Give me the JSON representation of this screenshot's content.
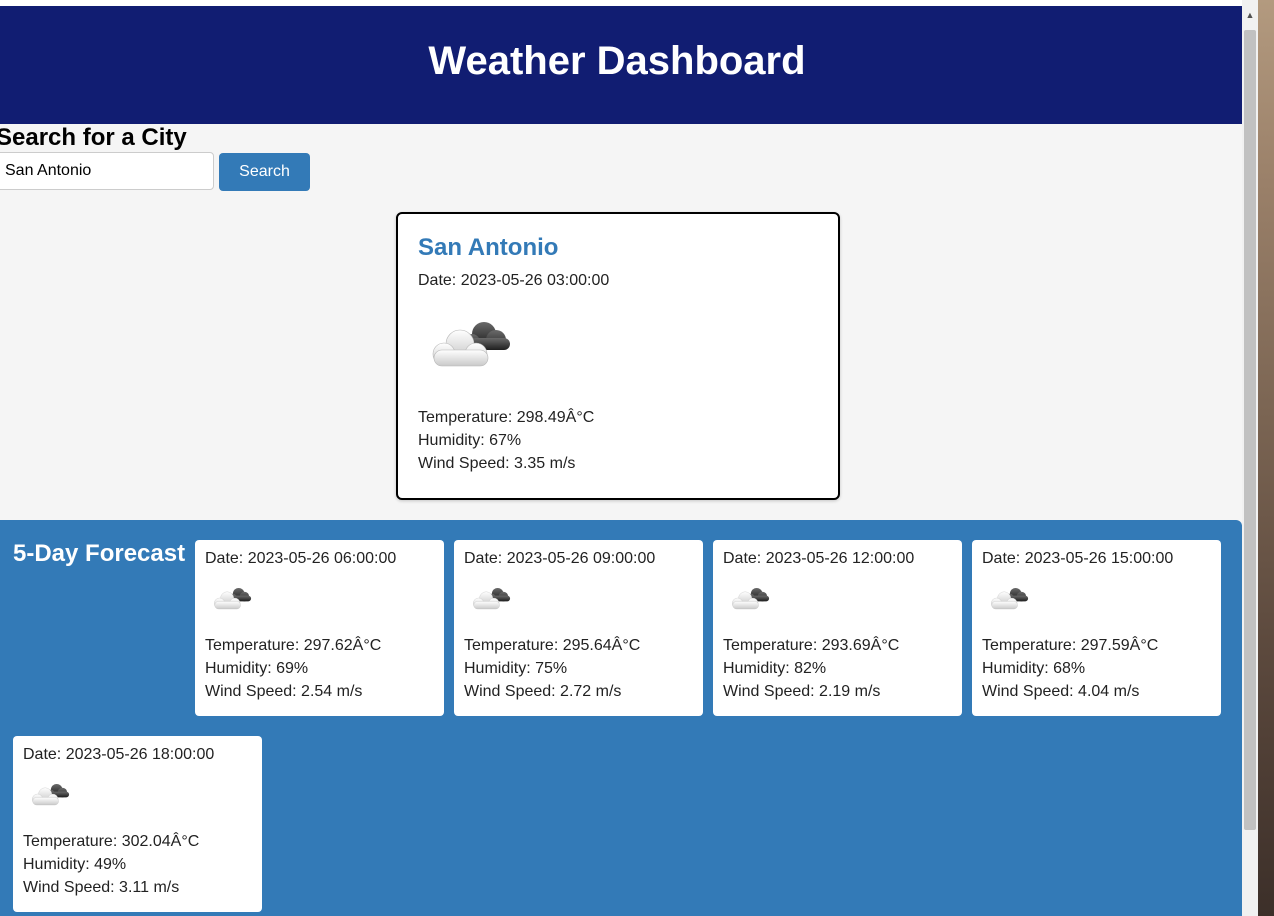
{
  "header": {
    "title": "Weather Dashboard"
  },
  "search": {
    "title": "Search for a City",
    "input_value": "San Antonio",
    "button_label": "Search"
  },
  "current": {
    "city": "San Antonio",
    "date": "Date: 2023-05-26 03:00:00",
    "icon": "cloud-icon",
    "temperature": "Temperature: 298.49Â°C",
    "humidity": "Humidity: 67%",
    "wind": "Wind Speed: 3.35 m/s"
  },
  "forecast": {
    "title": "5-Day Forecast",
    "days": [
      {
        "date": "Date: 2023-05-26 06:00:00",
        "icon": "cloud-icon",
        "temperature": "Temperature: 297.62Â°C",
        "humidity": "Humidity: 69%",
        "wind": "Wind Speed: 2.54 m/s"
      },
      {
        "date": "Date: 2023-05-26 09:00:00",
        "icon": "cloud-icon",
        "temperature": "Temperature: 295.64Â°C",
        "humidity": "Humidity: 75%",
        "wind": "Wind Speed: 2.72 m/s"
      },
      {
        "date": "Date: 2023-05-26 12:00:00",
        "icon": "cloud-icon",
        "temperature": "Temperature: 293.69Â°C",
        "humidity": "Humidity: 82%",
        "wind": "Wind Speed: 2.19 m/s"
      },
      {
        "date": "Date: 2023-05-26 15:00:00",
        "icon": "cloud-icon",
        "temperature": "Temperature: 297.59Â°C",
        "humidity": "Humidity: 68%",
        "wind": "Wind Speed: 4.04 m/s"
      },
      {
        "date": "Date: 2023-05-26 18:00:00",
        "icon": "cloud-icon",
        "temperature": "Temperature: 302.04Â°C",
        "humidity": "Humidity: 49%",
        "wind": "Wind Speed: 3.11 m/s"
      }
    ]
  },
  "colors": {
    "header_bg": "#111d72",
    "accent": "#337ab7",
    "page_bg": "#f5f5f5"
  }
}
